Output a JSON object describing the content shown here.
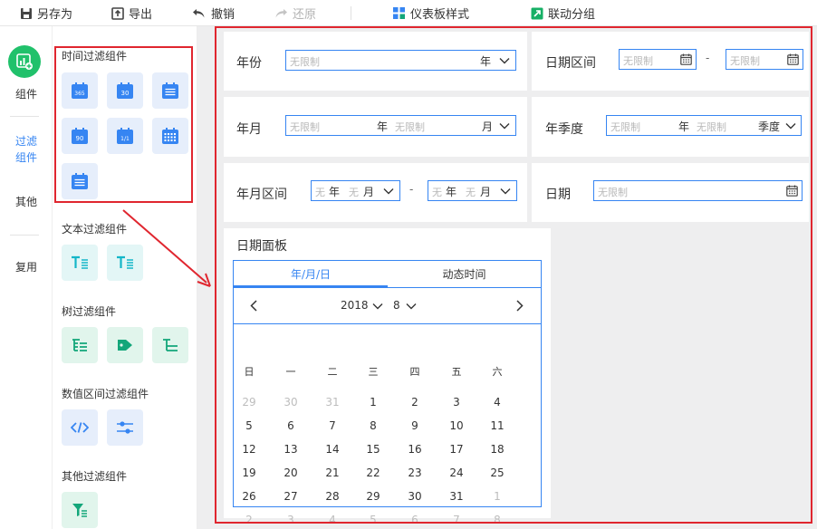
{
  "toolbar": {
    "save_as": "另存为",
    "export": "导出",
    "undo": "撤销",
    "redo": "还原",
    "dashboard_style": "仪表板样式",
    "linkage_group": "联动分组"
  },
  "left_nav": {
    "component": "组件",
    "filter_component_l1": "过滤",
    "filter_component_l2": "组件",
    "other": "其他",
    "reuse": "复用"
  },
  "panel": {
    "time_filter_title": "时间过滤组件",
    "time_icons": [
      {
        "icon": "calendar-365-icon",
        "text": "365"
      },
      {
        "icon": "calendar-30-icon",
        "text": "30"
      },
      {
        "icon": "calendar-lines-icon",
        "text": ""
      },
      {
        "icon": "calendar-90-icon",
        "text": "90"
      },
      {
        "icon": "calendar-1-1-icon",
        "text": "1/1"
      },
      {
        "icon": "calendar-grid-icon",
        "text": ""
      },
      {
        "icon": "calendar-lines-icon",
        "text": ""
      }
    ],
    "text_filter_title": "文本过滤组件",
    "tree_filter_title": "树过滤组件",
    "number_range_title": "数值区间过滤组件",
    "other_filter_title": "其他过滤组件"
  },
  "filters": {
    "year": {
      "label": "年份",
      "placeholder": "无限制",
      "unit": "年"
    },
    "date_range": {
      "label": "日期区间",
      "start_placeholder": "无限制",
      "end_placeholder": "无限制",
      "separator": "-"
    },
    "year_month": {
      "label": "年月",
      "year_placeholder": "无限制",
      "year_unit": "年",
      "month_placeholder": "无限制",
      "month_unit": "月"
    },
    "year_quarter": {
      "label": "年季度",
      "year_placeholder": "无限制",
      "year_unit": "年",
      "quarter_placeholder": "无限制",
      "quarter_unit": "季度"
    },
    "year_month_range": {
      "label": "年月区间",
      "ph": "无",
      "year_unit": "年",
      "month_unit": "月",
      "separator": "-"
    },
    "date": {
      "label": "日期",
      "placeholder": "无限制"
    }
  },
  "date_panel": {
    "title": "日期面板",
    "tabs": [
      "年/月/日",
      "动态时间"
    ],
    "year": "2018",
    "month": "8",
    "weekdays": [
      "日",
      "一",
      "二",
      "三",
      "四",
      "五",
      "六"
    ],
    "weeks": [
      [
        {
          "d": "29",
          "m": true
        },
        {
          "d": "30",
          "m": true
        },
        {
          "d": "31",
          "m": true
        },
        {
          "d": "1"
        },
        {
          "d": "2"
        },
        {
          "d": "3"
        },
        {
          "d": "4"
        }
      ],
      [
        {
          "d": "5"
        },
        {
          "d": "6"
        },
        {
          "d": "7"
        },
        {
          "d": "8"
        },
        {
          "d": "9"
        },
        {
          "d": "10"
        },
        {
          "d": "11"
        }
      ],
      [
        {
          "d": "12"
        },
        {
          "d": "13"
        },
        {
          "d": "14"
        },
        {
          "d": "15"
        },
        {
          "d": "16"
        },
        {
          "d": "17"
        },
        {
          "d": "18"
        }
      ],
      [
        {
          "d": "19"
        },
        {
          "d": "20"
        },
        {
          "d": "21"
        },
        {
          "d": "22"
        },
        {
          "d": "23"
        },
        {
          "d": "24"
        },
        {
          "d": "25"
        }
      ],
      [
        {
          "d": "26"
        },
        {
          "d": "27"
        },
        {
          "d": "28"
        },
        {
          "d": "29"
        },
        {
          "d": "30"
        },
        {
          "d": "31"
        },
        {
          "d": "1",
          "m": true
        }
      ],
      [
        {
          "d": "2",
          "m": true
        },
        {
          "d": "3",
          "m": true
        },
        {
          "d": "4",
          "m": true
        },
        {
          "d": "5",
          "m": true
        },
        {
          "d": "6",
          "m": true
        },
        {
          "d": "7",
          "m": true
        },
        {
          "d": "8",
          "m": true
        }
      ]
    ]
  },
  "colors": {
    "accent": "#3685f2",
    "highlight_red": "#e0262f",
    "active_green": "#21c16b",
    "teal": "#14b6c8",
    "green": "#13a67a"
  }
}
